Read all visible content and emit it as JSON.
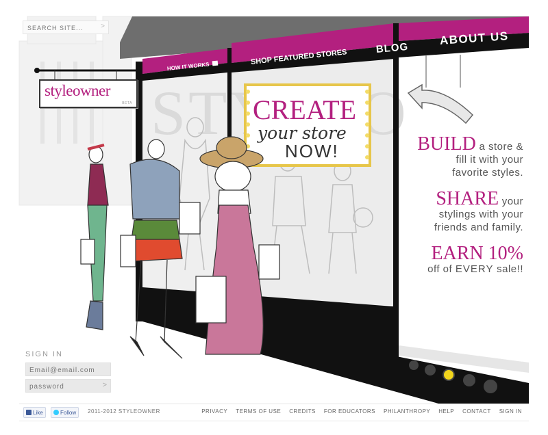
{
  "search": {
    "placeholder": "SEARCH SITE...",
    "go_glyph": ">"
  },
  "logo": {
    "brand": "styleowner",
    "sub": "BETA"
  },
  "nav": {
    "how_it_works": "HOW IT WORKS",
    "shop_featured": "SHOP FEATURED STORES",
    "blog": "BLOG",
    "about": "ABOUT US"
  },
  "window_sign": {
    "line1": "CREATE",
    "line2": "your store",
    "line3": "NOW!"
  },
  "backdrop_text": "STYLEO",
  "promo": {
    "build_word": "BUILD",
    "build_rest_1": " a store &",
    "build_rest_2": "fill it with your",
    "build_rest_3": "favorite styles.",
    "share_word": "SHARE",
    "share_rest_1": " your",
    "share_rest_2": "stylings with your",
    "share_rest_3": "friends and family.",
    "earn_word": "EARN 10%",
    "earn_rest_a": "off of ",
    "earn_rest_b": "EVERY",
    "earn_rest_c": " sale!!"
  },
  "carousel": {
    "count": 4,
    "active_index": 1
  },
  "signin": {
    "title": "SIGN IN",
    "email_placeholder": "Email@email.com",
    "password_placeholder": "password",
    "go_glyph": ">"
  },
  "footer": {
    "like_label": "Like",
    "follow_label": "Follow",
    "copyright": "2011-2012 STYLEOWNER",
    "links": [
      "PRIVACY",
      "TERMS OF USE",
      "CREDITS",
      "FOR EDUCATORS",
      "PHILANTHROPY",
      "HELP",
      "CONTACT",
      "SIGN IN"
    ]
  },
  "colors": {
    "brand_magenta": "#b3207f",
    "awning_grey": "#6e6e6e",
    "storefront_black": "#111111",
    "active_dot": "#f2d51c"
  }
}
